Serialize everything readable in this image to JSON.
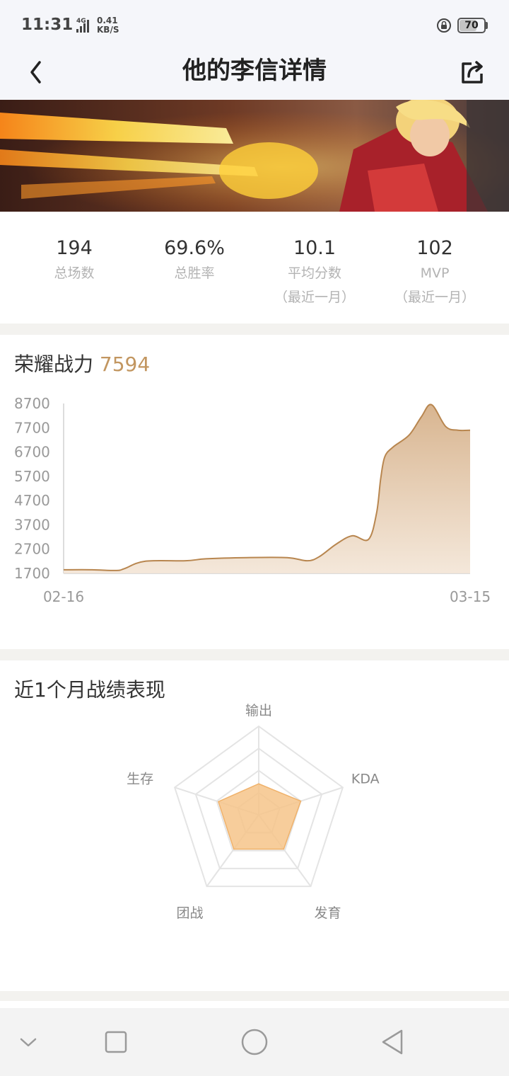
{
  "status_bar": {
    "time": "11:31",
    "network": "4G",
    "speed_value": "0.41",
    "speed_unit": "KB/S",
    "battery": "70",
    "battery_level": 0.7
  },
  "header": {
    "title": "他的李信详情",
    "back_icon": "chevron-left-icon",
    "share_icon": "share-icon"
  },
  "stats": [
    {
      "value": "194",
      "label": "总场数",
      "sub": ""
    },
    {
      "value": "69.6%",
      "label": "总胜率",
      "sub": ""
    },
    {
      "value": "10.1",
      "label": "平均分数",
      "sub": "（最近一月）"
    },
    {
      "value": "102",
      "label": "MVP",
      "sub": "（最近一月）"
    }
  ],
  "power": {
    "title": "荣耀战力",
    "value": "7594"
  },
  "chart_data": {
    "type": "area",
    "title": "荣耀战力",
    "ylim": [
      1700,
      8700
    ],
    "yticks": [
      "8700",
      "7700",
      "6700",
      "5700",
      "4700",
      "3700",
      "2700",
      "1700"
    ],
    "xticks": [
      "02-16",
      "03-15"
    ],
    "grid": false,
    "color": "#b8864f",
    "fill": "#d6b18a",
    "x": [
      0,
      0.07,
      0.13,
      0.15,
      0.2,
      0.3,
      0.35,
      0.45,
      0.55,
      0.6,
      0.63,
      0.67,
      0.71,
      0.75,
      0.77,
      0.78,
      0.79,
      0.81,
      0.85,
      0.88,
      0.905,
      0.94,
      0.97,
      1.0
    ],
    "values": [
      1850,
      1850,
      1820,
      1900,
      2200,
      2220,
      2300,
      2350,
      2350,
      2220,
      2400,
      2900,
      3250,
      3100,
      4200,
      5600,
      6500,
      6900,
      7400,
      8150,
      8650,
      7750,
      7600,
      7600
    ]
  },
  "performance": {
    "title": "近1个月战绩表现",
    "radar": {
      "axes": [
        "输出",
        "KDA",
        "发育",
        "团战",
        "生存"
      ],
      "values": [
        0.35,
        0.5,
        0.48,
        0.48,
        0.48
      ],
      "fill": "#f6c48a"
    }
  },
  "nav": {
    "icons": [
      "chevron-down-icon",
      "recents-square-icon",
      "home-circle-icon",
      "back-triangle-icon"
    ]
  }
}
